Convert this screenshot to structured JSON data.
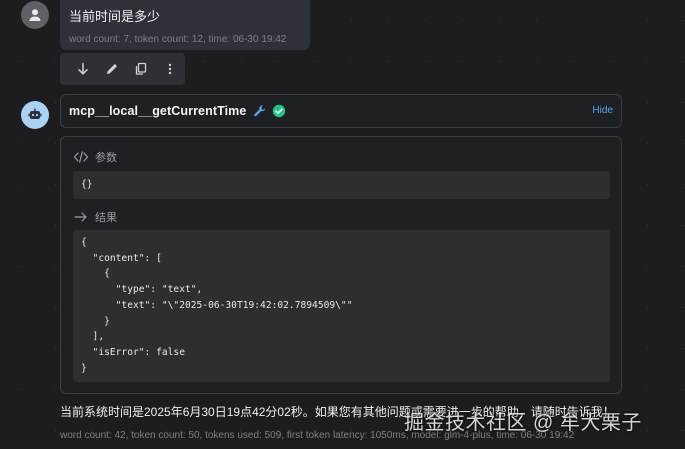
{
  "user_message": {
    "text": "当前时间是多少",
    "meta": "word count: 7, token count: 12, time: 06-30 19:42"
  },
  "action_icons": [
    "download-icon",
    "edit-icon",
    "copy-icon",
    "more-icon"
  ],
  "tool_call": {
    "name": "mcp__local__getCurrentTime",
    "hide_label": "Hide",
    "params_label": "参数",
    "params_code": "{}",
    "result_label": "结果",
    "result_code": "{\n  \"content\": [\n    {\n      \"type\": \"text\",\n      \"text\": \"\\\"2025-06-30T19:42:02.7894509\\\"\"\n    }\n  ],\n  \"isError\": false\n}"
  },
  "assistant_message": {
    "text": "当前系统时间是2025年6月30日19点42分02秒。如果您有其他问题或需要进一步的帮助，请随时告诉我！",
    "meta": "word count: 42, token count: 50, tokens used: 509, first token latency: 1050ms, model: glm-4-plus, time: 06-30 19:42"
  },
  "watermark": "掘金技术社区 @ 牟大栗子",
  "colors": {
    "accent_link": "#5aa3f0",
    "success": "#27c28a",
    "bot_avatar": "#a9d2f5"
  }
}
